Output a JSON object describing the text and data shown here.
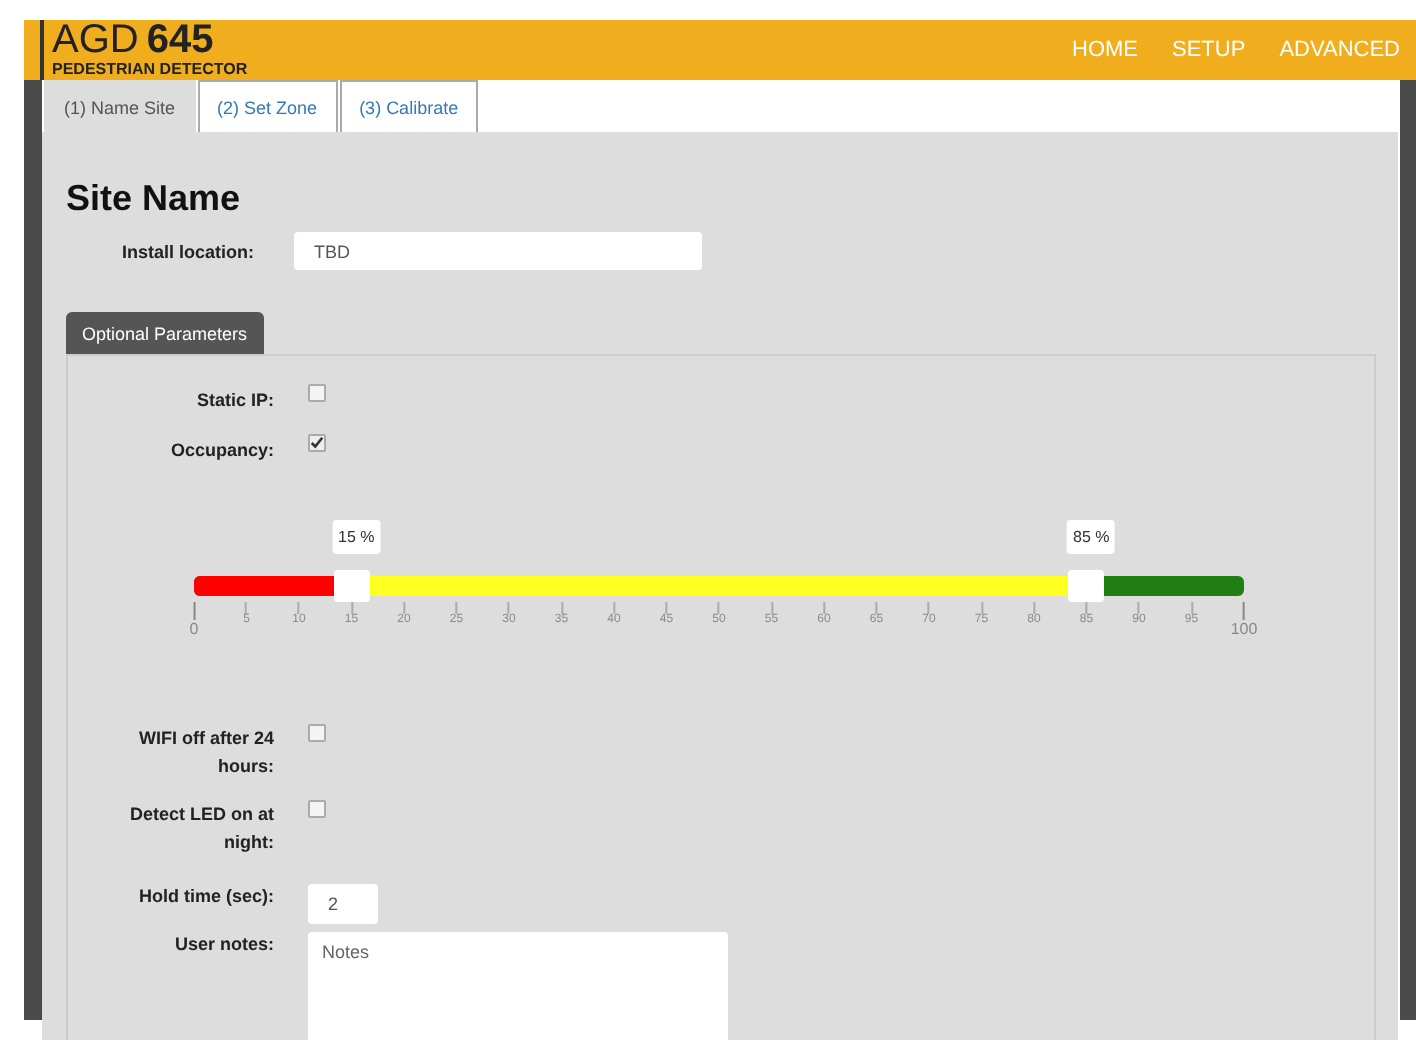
{
  "header": {
    "logo_light": "AGD",
    "logo_bold": "645",
    "subtitle": "PEDESTRIAN DETECTOR",
    "nav": [
      "HOME",
      "SETUP",
      "ADVANCED"
    ]
  },
  "tabs": [
    {
      "label": "(1) Name Site",
      "selected": true
    },
    {
      "label": "(2) Set Zone",
      "selected": false
    },
    {
      "label": "(3) Calibrate",
      "selected": false
    }
  ],
  "heading": "Site Name",
  "install_location": {
    "label": "Install location:",
    "value": "TBD"
  },
  "optional_button": "Optional Parameters",
  "checkboxes": [
    {
      "label": "Static IP:",
      "checked": false
    },
    {
      "label": "Occupancy:",
      "checked": true
    }
  ],
  "slider": {
    "low": {
      "level": 0.15,
      "reading": "15 %"
    },
    "high": {
      "level": 0.85,
      "reading": "85 %"
    },
    "ticks": [
      {
        "label": "0",
        "major": true
      },
      {
        "label": "5",
        "major": false
      },
      {
        "label": "10",
        "major": false
      },
      {
        "label": "15",
        "major": false
      },
      {
        "label": "20",
        "major": false
      },
      {
        "label": "25",
        "major": false
      },
      {
        "label": "30",
        "major": false
      },
      {
        "label": "35",
        "major": false
      },
      {
        "label": "40",
        "major": false
      },
      {
        "label": "45",
        "major": false
      },
      {
        "label": "50",
        "major": false
      },
      {
        "label": "55",
        "major": false
      },
      {
        "label": "60",
        "major": false
      },
      {
        "label": "65",
        "major": false
      },
      {
        "label": "70",
        "major": false
      },
      {
        "label": "75",
        "major": false
      },
      {
        "label": "80",
        "major": false
      },
      {
        "label": "85",
        "major": false
      },
      {
        "label": "90",
        "major": false
      },
      {
        "label": "95",
        "major": false
      },
      {
        "label": "100",
        "major": true
      }
    ]
  },
  "checkboxes_2": [
    {
      "label": "WIFI off after 24 hours:",
      "checked": false
    },
    {
      "label": "Detect LED on at night:",
      "checked": false
    }
  ],
  "hold_time": {
    "label": "Hold time (sec):",
    "value": "2"
  },
  "user_notes": {
    "label": "User notes:",
    "placeholder": "Notes"
  }
}
